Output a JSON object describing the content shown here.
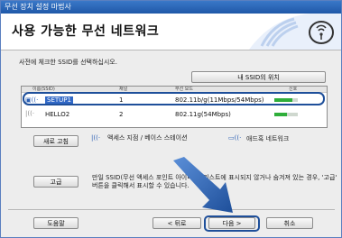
{
  "window": {
    "title": "무선 장치 설정 마법사"
  },
  "header": {
    "title": "사용 가능한 무선 네트워크"
  },
  "instruction": "사전에 체크한 SSID를 선택하십시오.",
  "ssid_location_button": "내 SSID의 위치",
  "list": {
    "columns": [
      "이름(SSID)",
      "채널",
      "무선 모드",
      "신호"
    ],
    "rows": [
      {
        "name": "SETUP1",
        "channel": "1",
        "mode": "802.11b/g(11Mbps/54Mbps)",
        "signal_level": 0.75,
        "selected": true
      },
      {
        "name": "HELLO2",
        "channel": "2",
        "mode": "802.11g(54Mbps)",
        "signal_level": 0.55,
        "selected": false
      }
    ]
  },
  "legend": {
    "access_point": "액세스 지점 / 베이스 스테이션",
    "adhoc": "애드혹 네트워크"
  },
  "buttons": {
    "refresh": "새로 고침",
    "advanced": "고급",
    "help": "도움말",
    "back": "< 뒤로",
    "next": "다음 >",
    "cancel": "취소"
  },
  "note": "만일 SSID(무선 액세스 포인트 아이디)가 리스트에 표시되지 않거나 숨겨져 있는 경우, '고급' 버튼을 클릭해서 표시할 수 있습니다.",
  "colors": {
    "accent": "#1e4f9a",
    "selection": "#3168c6",
    "signal": "#2fae3a"
  }
}
